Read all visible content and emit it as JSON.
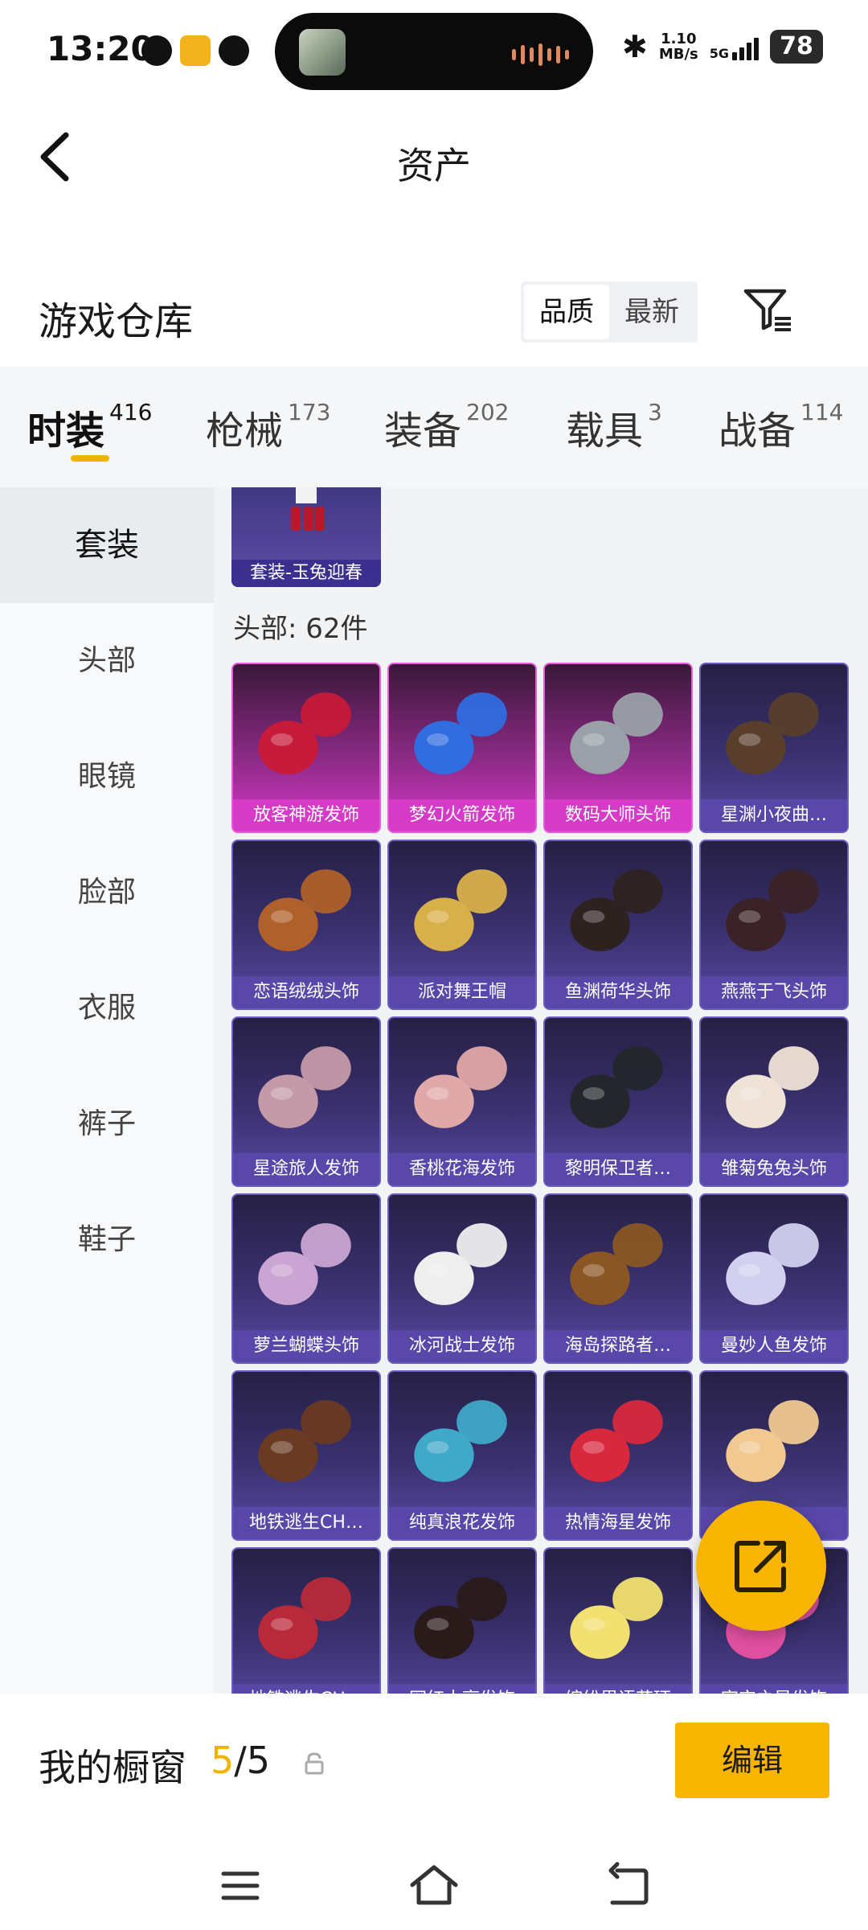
{
  "status_bar": {
    "time": "13:20",
    "net_speed_value": "1.10",
    "net_speed_unit": "MB/s",
    "network_type": "5G",
    "battery": "78"
  },
  "header": {
    "title": "资产"
  },
  "warehouse": {
    "title": "游戏仓库",
    "sort_options": [
      "品质",
      "最新"
    ],
    "active_sort": "品质"
  },
  "tabs": [
    {
      "label": "时装",
      "count": "416"
    },
    {
      "label": "枪械",
      "count": "173"
    },
    {
      "label": "装备",
      "count": "202"
    },
    {
      "label": "载具",
      "count": "3"
    },
    {
      "label": "战备",
      "count": "114"
    }
  ],
  "side_menu": [
    "套装",
    "头部",
    "眼镜",
    "脸部",
    "衣服",
    "裤子",
    "鞋子"
  ],
  "suit_card": {
    "label": "套装-玉兔迎春"
  },
  "section": {
    "title": "头部: 62件"
  },
  "items": [
    {
      "label": "放客神游发饰",
      "quality": "pink",
      "color": "#c81a3a"
    },
    {
      "label": "梦幻火箭发饰",
      "quality": "pink",
      "color": "#2f6de0"
    },
    {
      "label": "数码大师头饰",
      "quality": "pink",
      "color": "#9aa0a8"
    },
    {
      "label": "星渊小夜曲…",
      "quality": "purple",
      "color": "#5a3e2c"
    },
    {
      "label": "恋语绒绒头饰",
      "quality": "purple",
      "color": "#b0602a"
    },
    {
      "label": "派对舞王帽",
      "quality": "purple",
      "color": "#d8b04a"
    },
    {
      "label": "鱼渊荷华头饰",
      "quality": "purple",
      "color": "#2e2220"
    },
    {
      "label": "燕燕于飞头饰",
      "quality": "purple",
      "color": "#3a2226"
    },
    {
      "label": "星途旅人发饰",
      "quality": "purple",
      "color": "#c49aa8"
    },
    {
      "label": "香桃花海发饰",
      "quality": "purple",
      "color": "#e0a8a8"
    },
    {
      "label": "黎明保卫者…",
      "quality": "purple",
      "color": "#24262c"
    },
    {
      "label": "雏菊兔兔头饰",
      "quality": "purple",
      "color": "#efe2d6"
    },
    {
      "label": "萝兰蝴蝶头饰",
      "quality": "purple",
      "color": "#caa4d2"
    },
    {
      "label": "冰河战士发饰",
      "quality": "purple",
      "color": "#eeeeee"
    },
    {
      "label": "海岛探路者…",
      "quality": "purple",
      "color": "#8a5624"
    },
    {
      "label": "曼妙人鱼发饰",
      "quality": "purple",
      "color": "#d2d0ee"
    },
    {
      "label": "地铁逃生CH…",
      "quality": "purple",
      "color": "#6a3a22"
    },
    {
      "label": "纯真浪花发饰",
      "quality": "purple",
      "color": "#40a8c8"
    },
    {
      "label": "热情海星发饰",
      "quality": "purple",
      "color": "#d8283e"
    },
    {
      "label": "…",
      "quality": "purple",
      "color": "#f0c890"
    },
    {
      "label": "地铁逃生CH…",
      "quality": "purple",
      "color": "#b82a3a"
    },
    {
      "label": "网红大亨发饰",
      "quality": "purple",
      "color": "#2a1a1a"
    },
    {
      "label": "缤纷里语花环",
      "quality": "purple",
      "color": "#f2e070"
    },
    {
      "label": "宇宙之星发饰",
      "quality": "purple",
      "color": "#e050a0"
    }
  ],
  "showcase": {
    "label": "我的橱窗",
    "current": "5",
    "separator": "/",
    "total": "5",
    "edit_label": "编辑"
  },
  "colors": {
    "accent": "#f7b500",
    "pink_quality": "#d838c8",
    "purple_quality": "#5a4aa4"
  }
}
